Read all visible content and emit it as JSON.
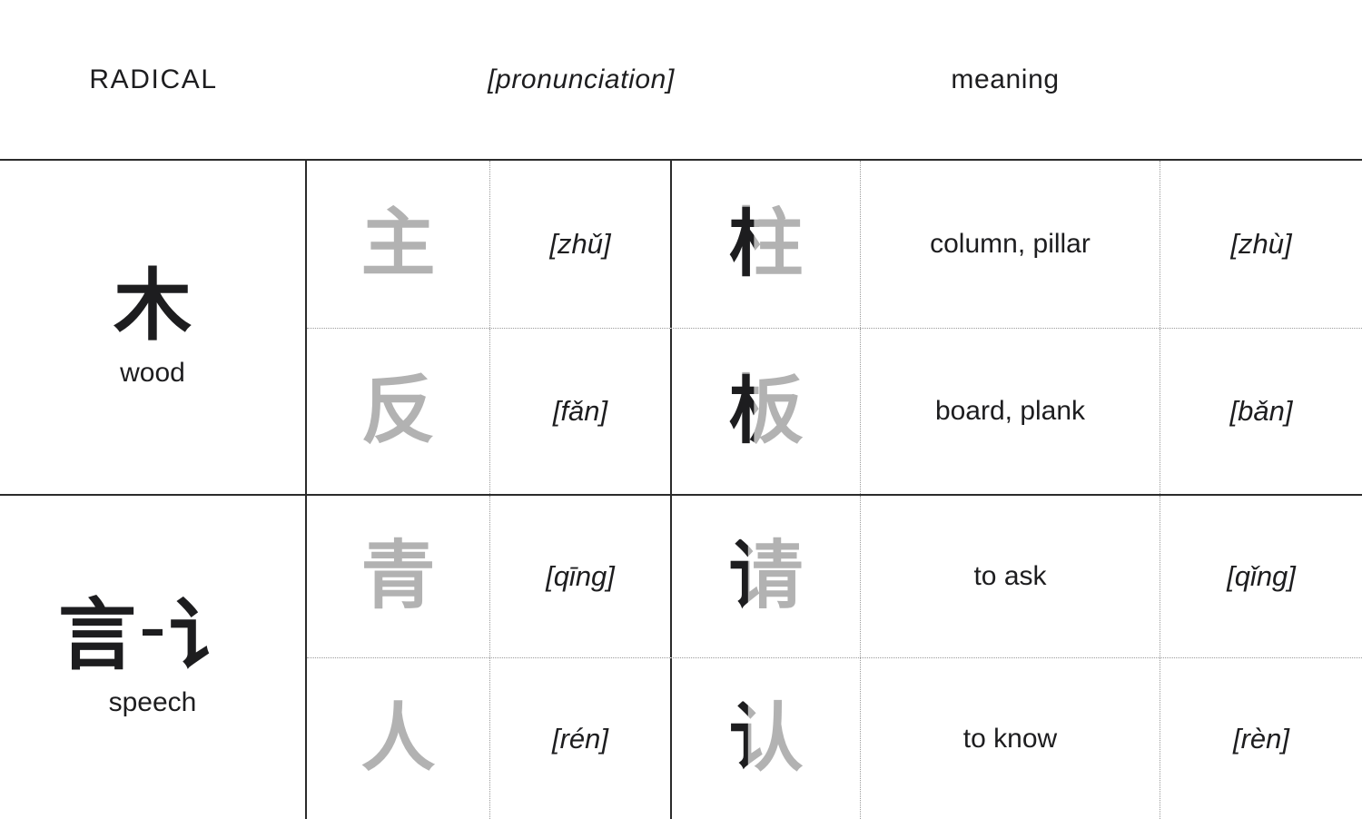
{
  "header": {
    "radical_label": "RADICAL",
    "pronunciation_label": "[pronunciation]",
    "meaning_label": "meaning"
  },
  "colors": {
    "text": "#1d1d1f",
    "phonetic_gray": "#b2b2b2",
    "solid_rule": "#2b2b2b",
    "dotted_rule": "#9a9a9a",
    "background": "#ffffff"
  },
  "groups": [
    {
      "radical": "木",
      "radical_meaning": "wood",
      "rows": [
        {
          "phonetic": "主",
          "phonetic_pron": "[zhǔ]",
          "compound": "柱",
          "meaning": "column, pillar",
          "compound_pron": "[zhù]"
        },
        {
          "phonetic": "反",
          "phonetic_pron": "[fǎn]",
          "compound": "板",
          "meaning": "board, plank",
          "compound_pron": "[bǎn]"
        }
      ]
    },
    {
      "radical": "言",
      "radical_variant": "讠",
      "radical_separator": "–",
      "radical_meaning": "speech",
      "rows": [
        {
          "phonetic": "青",
          "phonetic_pron": "[qīng]",
          "compound": "请",
          "meaning": "to ask",
          "compound_pron": "[qǐng]"
        },
        {
          "phonetic": "人",
          "phonetic_pron": "[rén]",
          "compound": "认",
          "meaning": "to know",
          "compound_pron": "[rèn]"
        }
      ]
    }
  ]
}
